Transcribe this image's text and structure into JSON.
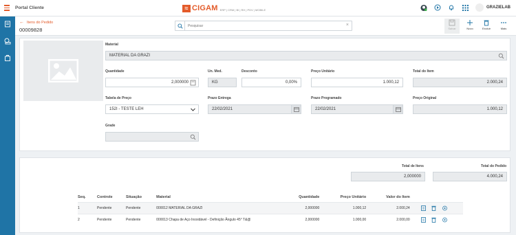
{
  "app": {
    "title": "Portal Cliente",
    "logo_text": "CIGAM",
    "logo_tagline": "ERP | CRM | BI | RH | PDV | MOBILE",
    "user_name": "GRAZIELAB"
  },
  "header": {
    "back_label": "Itens do Pedido",
    "order_number": "00009828",
    "search_placeholder": "Pesquisar"
  },
  "toolbar": {
    "save": "Salvar",
    "new": "Novo",
    "delete": "Excluir",
    "more": "Mais"
  },
  "item": {
    "material_label": "Material",
    "material_value": "MATERIAL DA GRAZI",
    "quantidade_label": "Quantidade",
    "quantidade_value": "2,000000",
    "un_med_label": "Un. Med.",
    "un_med_value": "KG",
    "desconto_label": "Desconto",
    "desconto_value": "0,00%",
    "preco_unit_label": "Preço Unitário",
    "preco_unit_value": "1.000,12",
    "total_item_label": "Total do Item",
    "total_item_value": "2.000,24",
    "tabela_label": "Tabela de Preço",
    "tabela_value": "152I - TESTE LEH",
    "prazo_entrega_label": "Prazo Entrega",
    "prazo_entrega_value": "22/02/2021",
    "prazo_prog_label": "Prazo Programado",
    "prazo_prog_value": "22/02/2021",
    "preco_orig_label": "Preço Original",
    "preco_orig_value": "1.000,12",
    "grade_label": "Grade",
    "grade_value": ""
  },
  "totals": {
    "itens_label": "Total de Itens",
    "itens_value": "2,000000",
    "pedido_label": "Total do Pedido",
    "pedido_value": "4.000,24"
  },
  "table": {
    "headers": [
      "Seq.",
      "Controle",
      "Situação",
      "Material",
      "Quantidade",
      "Preço Unitário",
      "Valor do Item"
    ],
    "rows": [
      [
        "1",
        "Pendente",
        "Pendente",
        "000012 MATERIAL DA GRAZI",
        "2,000000",
        "1.000,12",
        "2.000,24"
      ],
      [
        "2",
        "Pendente",
        "Pendente",
        "000013 Chapa de Aço Inoxidável - Definição Ângulo 45° T&@",
        "2,000000",
        "1.000,00",
        "2.000,00"
      ]
    ]
  },
  "colors": {
    "accent": "#e35b2a",
    "sidebar": "#1f74a6"
  }
}
